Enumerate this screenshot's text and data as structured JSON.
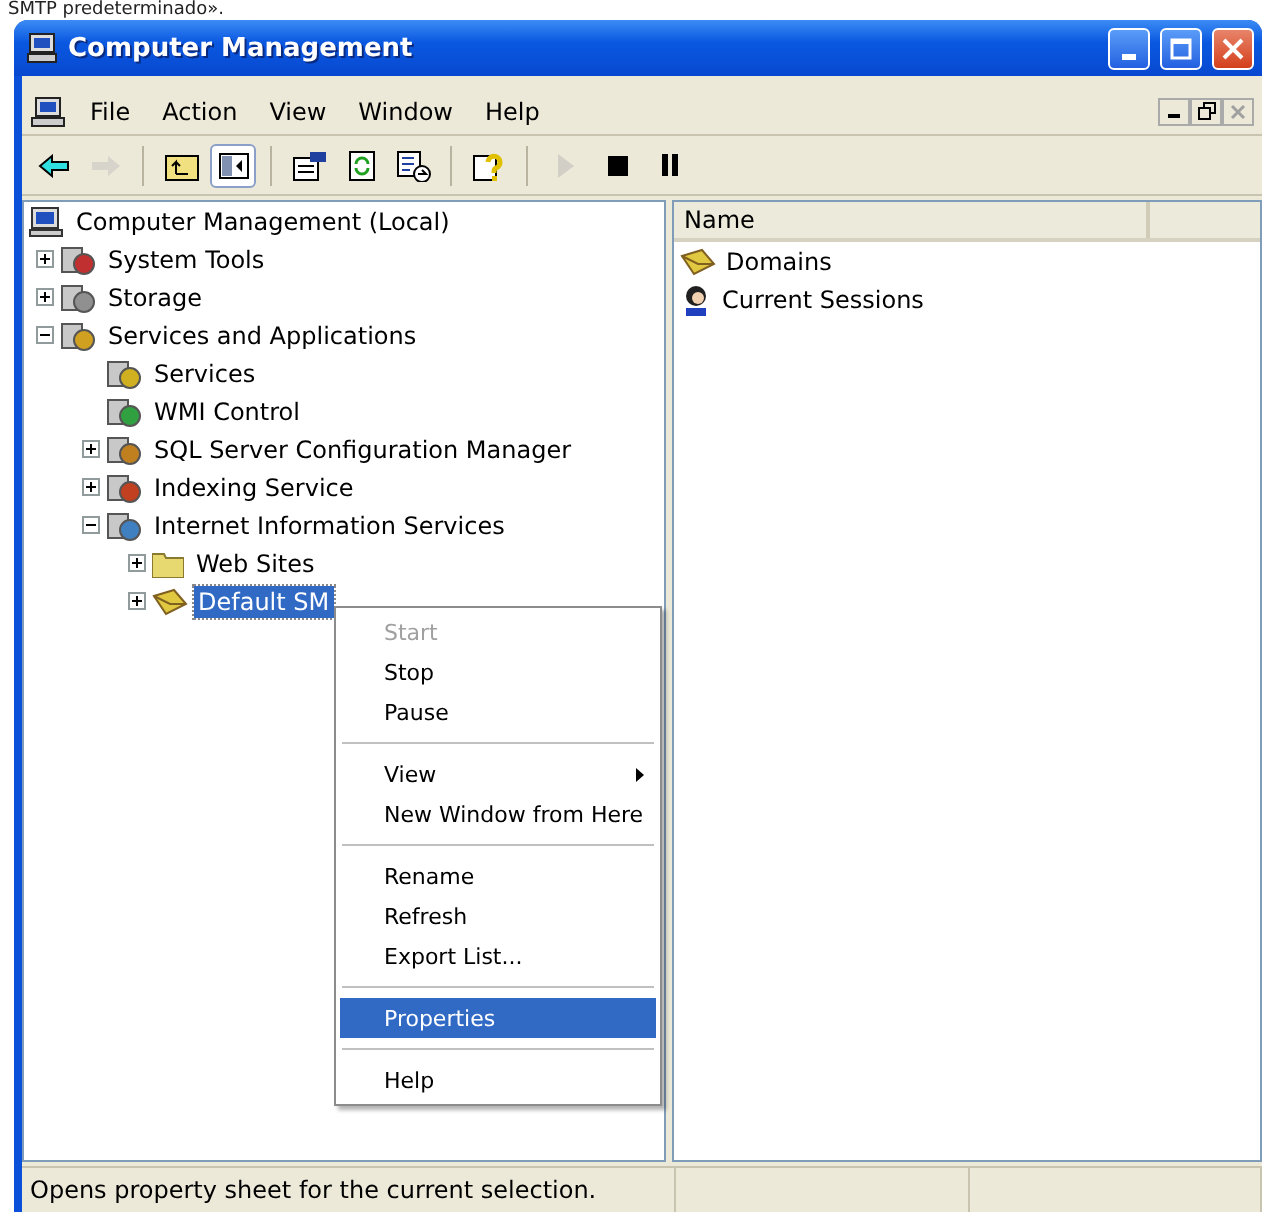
{
  "caption": "SMTP predeterminado».",
  "window": {
    "title": "Computer Management"
  },
  "menu_bar": [
    {
      "label": "File"
    },
    {
      "label": "Action"
    },
    {
      "label": "View"
    },
    {
      "label": "Window"
    },
    {
      "label": "Help"
    }
  ],
  "toolbar": [
    {
      "kind": "back",
      "disabled": false,
      "pressed": false
    },
    {
      "kind": "forward",
      "disabled": true,
      "pressed": false
    },
    {
      "kind": "separator"
    },
    {
      "kind": "up",
      "disabled": false,
      "pressed": false
    },
    {
      "kind": "tree",
      "disabled": false,
      "pressed": true
    },
    {
      "kind": "separator"
    },
    {
      "kind": "properties",
      "disabled": false,
      "pressed": false
    },
    {
      "kind": "refresh",
      "disabled": false,
      "pressed": false
    },
    {
      "kind": "export",
      "disabled": false,
      "pressed": false
    },
    {
      "kind": "separator"
    },
    {
      "kind": "help",
      "disabled": false,
      "pressed": false
    },
    {
      "kind": "separator"
    },
    {
      "kind": "play",
      "disabled": true,
      "pressed": false
    },
    {
      "kind": "stop",
      "disabled": false,
      "pressed": false
    },
    {
      "kind": "pause",
      "disabled": false,
      "pressed": false
    }
  ],
  "tree": [
    {
      "label": "Computer Management (Local)",
      "selected": false,
      "children": [
        {
          "label": "System Tools",
          "expanded": false,
          "selected": false
        },
        {
          "label": "Storage",
          "expanded": false,
          "selected": false
        },
        {
          "label": "Services and Applications",
          "expanded": true,
          "selected": false,
          "children": [
            {
              "label": "Services",
              "selected": false
            },
            {
              "label": "WMI Control",
              "selected": false
            },
            {
              "label": "SQL Server Configuration Manager",
              "expanded": false,
              "selected": false
            },
            {
              "label": "Indexing Service",
              "expanded": false,
              "selected": false
            },
            {
              "label": "Internet Information Services",
              "expanded": true,
              "selected": false,
              "children": [
                {
                  "label": "Web Sites",
                  "expanded": false,
                  "selected": false
                },
                {
                  "label": "Default SM",
                  "expanded": false,
                  "selected": true
                }
              ]
            }
          ]
        }
      ]
    }
  ],
  "list": {
    "columns": [
      "Name"
    ],
    "rows": [
      {
        "label": "Domains"
      },
      {
        "label": "Current Sessions"
      }
    ]
  },
  "context_menu": [
    {
      "kind": "item",
      "label": "Start",
      "disabled": true,
      "selected": false
    },
    {
      "kind": "item",
      "label": "Stop",
      "disabled": false,
      "selected": false
    },
    {
      "kind": "item",
      "label": "Pause",
      "disabled": false,
      "selected": false
    },
    {
      "kind": "separator"
    },
    {
      "kind": "submenu",
      "label": "View",
      "disabled": false,
      "selected": false
    },
    {
      "kind": "item",
      "label": "New Window from Here",
      "disabled": false,
      "selected": false
    },
    {
      "kind": "separator"
    },
    {
      "kind": "item",
      "label": "Rename",
      "disabled": false,
      "selected": false
    },
    {
      "kind": "item",
      "label": "Refresh",
      "disabled": false,
      "selected": false
    },
    {
      "kind": "item",
      "label": "Export List...",
      "disabled": false,
      "selected": false
    },
    {
      "kind": "separator"
    },
    {
      "kind": "item",
      "label": "Properties",
      "disabled": false,
      "selected": true
    },
    {
      "kind": "separator"
    },
    {
      "kind": "item",
      "label": "Help",
      "disabled": false,
      "selected": false
    }
  ],
  "status_bar": "Opens property sheet for the current selection."
}
